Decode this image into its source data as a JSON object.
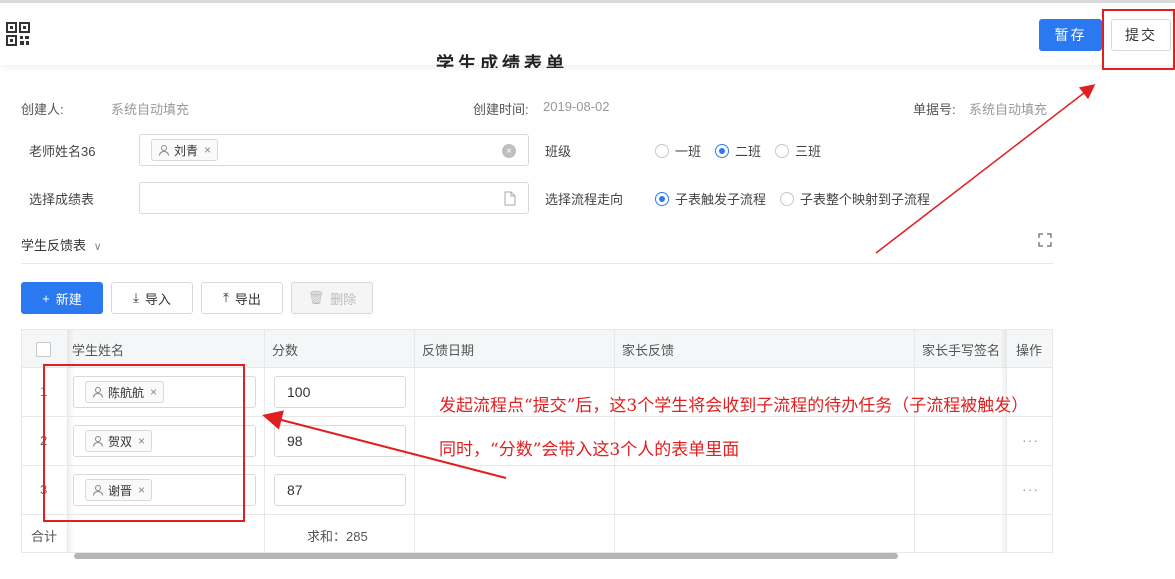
{
  "header": {
    "title_partial": "学生成绩表单",
    "save_label": "暂存",
    "submit_label": "提交"
  },
  "meta": {
    "creator_label": "创建人:",
    "creator_value": "系统自动填充",
    "created_time_label": "创建时间:",
    "created_time_value": "2019-08-02",
    "doc_no_label": "单据号:",
    "doc_no_value": "系统自动填充"
  },
  "form": {
    "teacher_label": "老师姓名36",
    "teacher_value": "刘青",
    "class_label": "班级",
    "class_options": [
      "一班",
      "二班",
      "三班"
    ],
    "class_selected": "二班",
    "score_table_label": "选择成绩表",
    "flow_label": "选择流程走向",
    "flow_options": [
      "子表触发子流程",
      "子表整个映射到子流程"
    ],
    "flow_selected": "子表触发子流程"
  },
  "subtable": {
    "title": "学生反馈表",
    "toolbar": {
      "new_label": "新建",
      "import_label": "导入",
      "export_label": "导出",
      "delete_label": "删除"
    },
    "columns": [
      "学生姓名",
      "分数",
      "反馈日期",
      "家长反馈",
      "家长手写签名",
      "操作"
    ],
    "rows": [
      {
        "index": "1",
        "student": "陈航航",
        "score": "100"
      },
      {
        "index": "2",
        "student": "贺双",
        "score": "98"
      },
      {
        "index": "3",
        "student": "谢晋",
        "score": "87"
      }
    ],
    "footer": {
      "total_label": "合计",
      "sum_text": "求和：285"
    },
    "more_label": "···"
  },
  "annotations": {
    "line1": "发起流程点“提交”后，这3个学生将会收到子流程的待办任务（子流程被触发）",
    "line2": "同时，“分数”会带入这3个人的表单里面",
    "color": "#e02020"
  },
  "colors": {
    "primary": "#2b79f0",
    "annotation_red": "#e02020"
  }
}
